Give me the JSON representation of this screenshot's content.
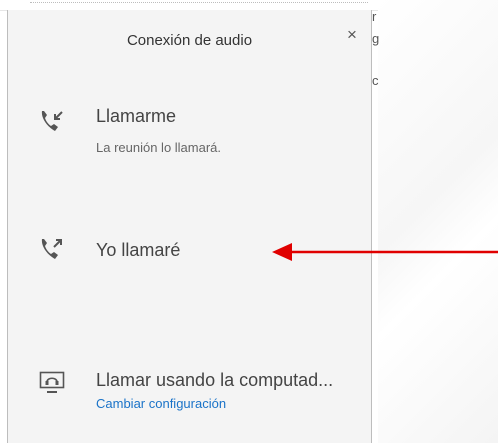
{
  "dialog": {
    "title": "Conexión de audio",
    "close_glyph": "×"
  },
  "options": [
    {
      "label": "Llamarme",
      "sublabel": "La reunión lo llamará.",
      "icon": "incoming-call-icon"
    },
    {
      "label": "Yo llamaré",
      "icon": "outgoing-call-icon"
    },
    {
      "label": "Llamar usando la computad...",
      "link": "Cambiar configuración",
      "icon": "computer-audio-icon"
    }
  ],
  "peek_text": [
    "r",
    "g",
    "c"
  ],
  "colors": {
    "panel_bg": "#f4f4f4",
    "text_primary": "#444444",
    "link": "#1a73c8",
    "annotation_arrow": "#e00000"
  }
}
